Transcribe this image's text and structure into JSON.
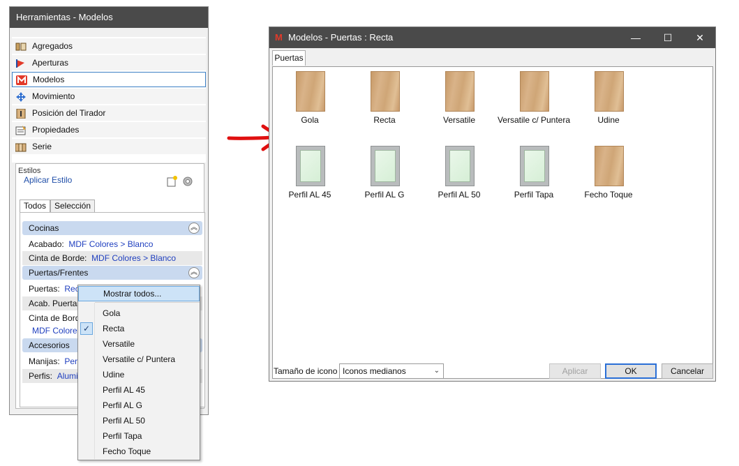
{
  "left_panel": {
    "title": "Herramientas - Modelos",
    "nav": [
      {
        "label": "Agregados",
        "icon": "add-icon"
      },
      {
        "label": "Aperturas",
        "icon": "hinge-icon"
      },
      {
        "label": "Modelos",
        "icon": "models-icon"
      },
      {
        "label": "Movimiento",
        "icon": "move-icon"
      },
      {
        "label": "Posición del Tirador",
        "icon": "handle-position-icon"
      },
      {
        "label": "Propiedades",
        "icon": "properties-icon"
      },
      {
        "label": "Serie",
        "icon": "series-icon"
      }
    ],
    "estilos_title": "Estilos",
    "apply_style": "Aplicar Estilo",
    "tabs": [
      "Todos",
      "Selección"
    ],
    "groups": {
      "cocinas": {
        "title": "Cocinas",
        "rows": [
          {
            "label": "Acabado:",
            "value": "MDF Colores > Blanco"
          },
          {
            "label": "Cinta de Borde:",
            "value": "MDF Colores > Blanco"
          }
        ]
      },
      "puertas": {
        "title": "Puertas/Frentes",
        "rows": [
          {
            "label": "Puertas:",
            "value": "Recta"
          },
          {
            "label": "Acab. Puertas:",
            "value": ""
          },
          {
            "label": "Cinta de Borde",
            "value": "MDF Colores"
          }
        ]
      },
      "accesorios": {
        "title": "Accesorios",
        "rows": [
          {
            "label": "Manijas:",
            "value": "Perfi"
          },
          {
            "label": "Perfis:",
            "value": "Alumin"
          }
        ]
      }
    }
  },
  "context_menu": {
    "show_all": "Mostrar todos...",
    "items": [
      "Gola",
      "Recta",
      "Versatile",
      "Versatile c/ Puntera",
      "Udine",
      "Perfil AL 45",
      "Perfil AL G",
      "Perfil AL 50",
      "Perfil Tapa",
      "Fecho Toque"
    ],
    "checked": "Recta"
  },
  "dialog": {
    "title": "Modelos - Puertas : Recta",
    "logo": "M",
    "tab": "Puertas",
    "models": [
      {
        "name": "Gola",
        "style": "wood"
      },
      {
        "name": "Recta",
        "style": "wood"
      },
      {
        "name": "Versatile",
        "style": "wood"
      },
      {
        "name": "Versatile c/ Puntera",
        "style": "wood"
      },
      {
        "name": "Udine",
        "style": "wood"
      },
      {
        "name": "Perfil AL 45",
        "style": "frame"
      },
      {
        "name": "Perfil AL G",
        "style": "frame"
      },
      {
        "name": "Perfil AL 50",
        "style": "frame"
      },
      {
        "name": "Perfil Tapa",
        "style": "frame"
      },
      {
        "name": "Fecho Toque",
        "style": "wood"
      }
    ],
    "icon_size_label": "Tamaño de icono",
    "icon_size_value": "Iconos medianos",
    "buttons": {
      "apply": "Aplicar",
      "ok": "OK",
      "cancel": "Cancelar"
    }
  },
  "colors": {
    "accent": "#2a6fd6",
    "title_bar": "#4a4a4a",
    "arrow": "#e01010"
  }
}
